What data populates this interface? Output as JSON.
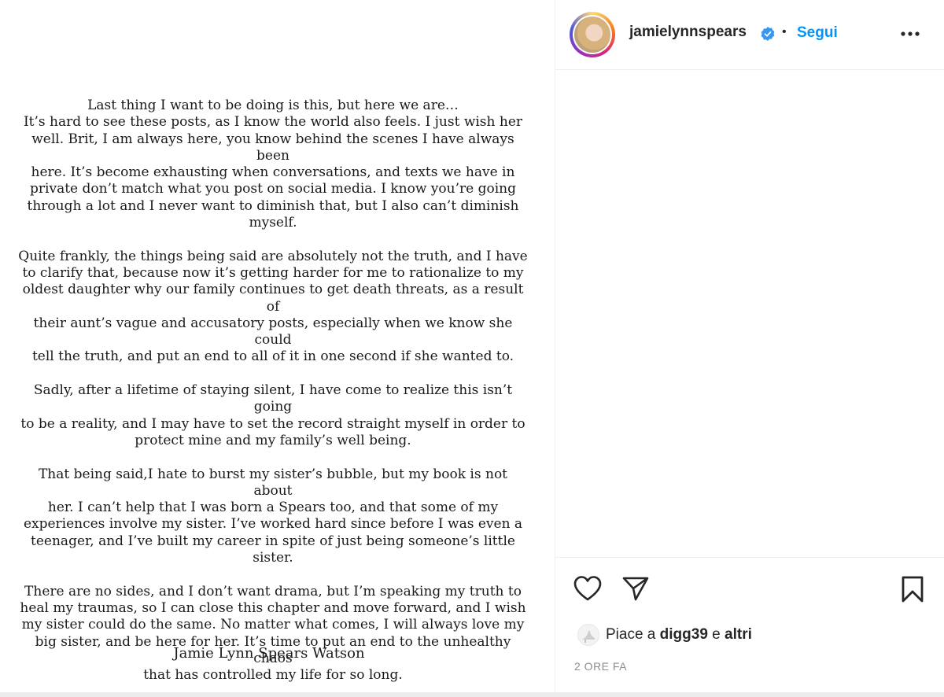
{
  "post": {
    "paragraphs": [
      [
        "Last thing I want to be doing is this, but here we are…",
        "It’s hard to see these posts, as I know the world also feels. I just wish her",
        "well. Brit, I am always here, you know behind the scenes I have always been",
        "here. It’s become exhausting when conversations, and texts we have in",
        "private don’t match what you post on social media. I know you’re going",
        "through a lot and I never want to diminish that, but I also can’t diminish",
        "myself."
      ],
      [
        "Quite frankly, the things being said are absolutely not the truth, and I have",
        "to clarify that, because now it’s getting harder for me to rationalize to my",
        "oldest daughter why our family continues to get death threats, as a result of",
        "their aunt’s vague and accusatory posts, especially when we know she could",
        "tell the truth, and put an end to all of it in one second if she wanted to."
      ],
      [
        "Sadly, after a lifetime of staying silent, I have come to realize this isn’t going",
        "to be a reality,  and I may have to set the record straight myself in order to",
        "protect mine and my family’s well being."
      ],
      [
        "That being said,I hate to burst my sister’s bubble, but my book is not about",
        "her. I can’t help that I was born a Spears too, and that some of my",
        "experiences involve my sister. I’ve worked hard since before I was even a",
        "teenager, and I’ve built my career in spite of just being someone’s little",
        "sister."
      ],
      [
        "There are no sides, and I don’t want drama, but I’m speaking my truth to",
        "heal my traumas, so I can close this chapter and move forward, and I wish",
        "my sister could do the same. No matter what comes, I will always love my",
        "big sister, and be here for her. It’s time to put an end to the unhealthy chaos",
        "that has controlled my life for so long."
      ]
    ],
    "signature": "Jamie Lynn Spears Watson"
  },
  "header": {
    "username": "jamielynnspears",
    "separator": "•",
    "follow_label": "Segui",
    "verified_icon": "verified-badge-icon",
    "more_icon": "more-options-icon"
  },
  "actions": {
    "like_icon": "heart-icon",
    "share_icon": "paper-plane-icon",
    "save_icon": "bookmark-icon"
  },
  "likes": {
    "prefix": "Piace a",
    "user": "digg39",
    "joiner": "e",
    "others": "altri"
  },
  "timestamp": "2 ORE FA",
  "colors": {
    "link_blue": "#0095f6",
    "verified_blue": "#3897f0",
    "muted": "#8e8e8e",
    "border": "#efefef"
  }
}
